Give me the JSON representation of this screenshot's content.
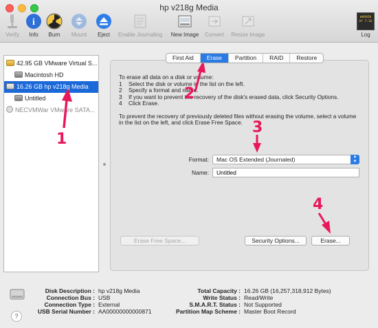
{
  "window": {
    "title": "hp v218g Media"
  },
  "toolbar": {
    "verify": "Verify",
    "info": "Info",
    "burn": "Burn",
    "mount": "Mount",
    "eject": "Eject",
    "enable_journaling": "Enable Journaling",
    "new_image": "New Image",
    "convert": "Convert",
    "resize_image": "Resize Image",
    "log": "Log",
    "log_badge_lines": [
      "WARNIN",
      "AY 7:36"
    ]
  },
  "sidebar": {
    "items": [
      {
        "label": "42.95 GB VMware Virtual S...",
        "level": 0,
        "selected": false,
        "dimmed": false
      },
      {
        "label": "Macintosh HD",
        "level": 1,
        "selected": false,
        "dimmed": false
      },
      {
        "label": "16.26 GB hp v218g Media",
        "level": 0,
        "selected": true,
        "dimmed": false
      },
      {
        "label": "Untitled",
        "level": 1,
        "selected": false,
        "dimmed": false
      },
      {
        "label": "NECVMWar VMware SATA...",
        "level": 0,
        "selected": false,
        "dimmed": true
      }
    ]
  },
  "tabs": [
    {
      "label": "First Aid",
      "active": false
    },
    {
      "label": "Erase",
      "active": true
    },
    {
      "label": "Partition",
      "active": false
    },
    {
      "label": "RAID",
      "active": false
    },
    {
      "label": "Restore",
      "active": false
    }
  ],
  "erase": {
    "intro": "To erase all data on a disk or volume:",
    "steps": [
      {
        "num": "1",
        "text": "Select the disk or volume in the list on the left."
      },
      {
        "num": "2",
        "text": "Specify a format and name."
      },
      {
        "num": "3",
        "text": "If you want to prevent the recovery of the disk's erased data, click Security Options."
      },
      {
        "num": "4",
        "text": "Click Erase."
      }
    ],
    "free_space_note": "To prevent the recovery of previously deleted files without erasing the volume, select a volume in the list on the left, and click Erase Free Space.",
    "format_label": "Format:",
    "format_value": "Mac OS Extended (Journaled)",
    "name_label": "Name:",
    "name_value": "Untitled",
    "erase_free_space_button": "Erase Free Space...",
    "security_options_button": "Security Options...",
    "erase_button": "Erase..."
  },
  "annotations": {
    "one": "1",
    "two": "2",
    "three": "3",
    "four": "4"
  },
  "annotation_color": "#e8185a",
  "info": {
    "left": [
      {
        "key": "Disk Description :",
        "value": "hp v218g Media"
      },
      {
        "key": "Connection Bus :",
        "value": "USB"
      },
      {
        "key": "Connection Type :",
        "value": "External"
      },
      {
        "key": "USB Serial Number :",
        "value": "AA00000000000871"
      }
    ],
    "right": [
      {
        "key": "Total Capacity :",
        "value": "16.26 GB (16,257,318,912 Bytes)"
      },
      {
        "key": "Write Status :",
        "value": "Read/Write"
      },
      {
        "key": "S.M.A.R.T. Status :",
        "value": "Not Supported"
      },
      {
        "key": "Partition Map Scheme :",
        "value": "Master Boot Record"
      }
    ],
    "help": "?"
  }
}
